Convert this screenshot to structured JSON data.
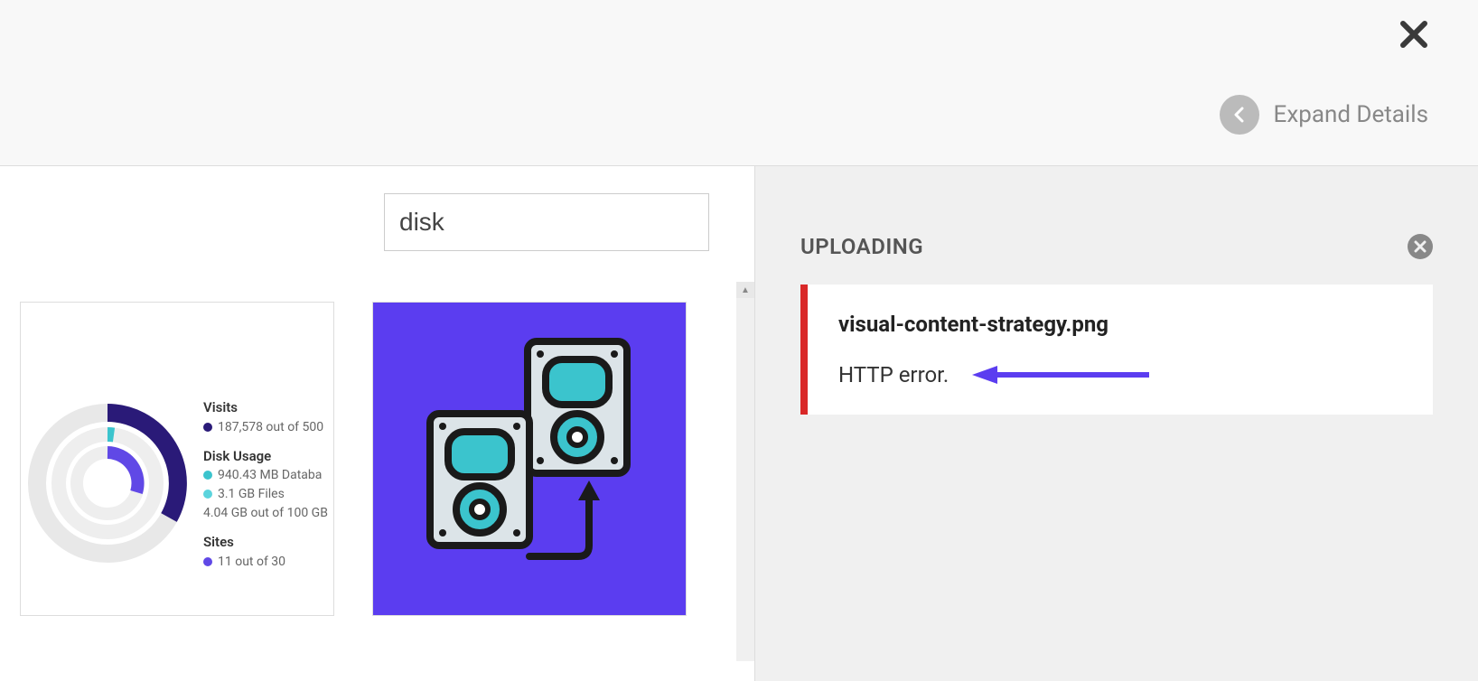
{
  "header": {
    "expand_label": "Expand Details"
  },
  "search": {
    "value": "disk"
  },
  "thumb1": {
    "stats": {
      "visits_heading": "Visits",
      "visits_line": "187,578 out of 500",
      "disk_heading": "Disk Usage",
      "disk_line1": "940.43 MB Databa",
      "disk_line2": "3.1 GB Files",
      "disk_line3": "4.04 GB out of 100 GB",
      "sites_heading": "Sites",
      "sites_line": "11 out of 30"
    },
    "colors": {
      "visits_dot": "#2a1a78",
      "disk_dot": "#3bc4cd",
      "sites_dot": "#6048e6"
    }
  },
  "uploading": {
    "title": "UPLOADING",
    "items": [
      {
        "filename": "visual-content-strategy.png",
        "error": "HTTP error."
      }
    ]
  }
}
